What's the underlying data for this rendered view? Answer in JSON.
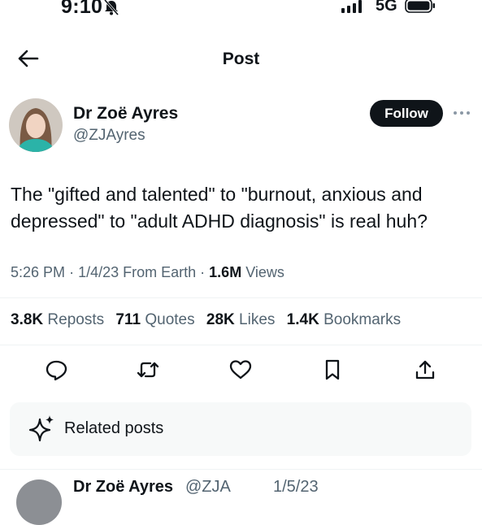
{
  "status_bar": {
    "time": "9:10",
    "network": "5G",
    "bell_icon": "bell-slash-icon",
    "battery_icon": "battery-icon"
  },
  "header": {
    "title": "Post",
    "back_icon": "arrow-left-icon"
  },
  "author": {
    "name": "Dr Zoë Ayres",
    "handle": "@ZJAyres",
    "follow_label": "Follow",
    "more_icon": "more-icon"
  },
  "post": {
    "text": "The \"gifted and talented\" to \"burnout, anxious and depressed\" to \"adult ADHD diagnosis\" is real huh?",
    "time": "5:26 PM",
    "date": "1/4/23",
    "source": "From Earth",
    "views_count": "1.6M",
    "views_label": "Views"
  },
  "stats": {
    "reposts_count": "3.8K",
    "reposts_label": "Reposts",
    "quotes_count": "711",
    "quotes_label": "Quotes",
    "likes_count": "28K",
    "likes_label": "Likes",
    "bookmarks_count": "1.4K",
    "bookmarks_label": "Bookmarks"
  },
  "actions": [
    "reply-icon",
    "repost-icon",
    "like-icon",
    "bookmark-icon",
    "share-icon"
  ],
  "related": {
    "label": "Related posts",
    "icon": "sparkle-icon"
  },
  "reply_preview": {
    "name": "Dr Zoë Ayres",
    "handle": "@ZJA",
    "date": "1/5/23"
  },
  "colors": {
    "text": "#0f1419",
    "secondary": "#536471",
    "divider": "#eff3f4",
    "related_bg": "#f7f9f9",
    "follow_bg": "#0f1419"
  }
}
